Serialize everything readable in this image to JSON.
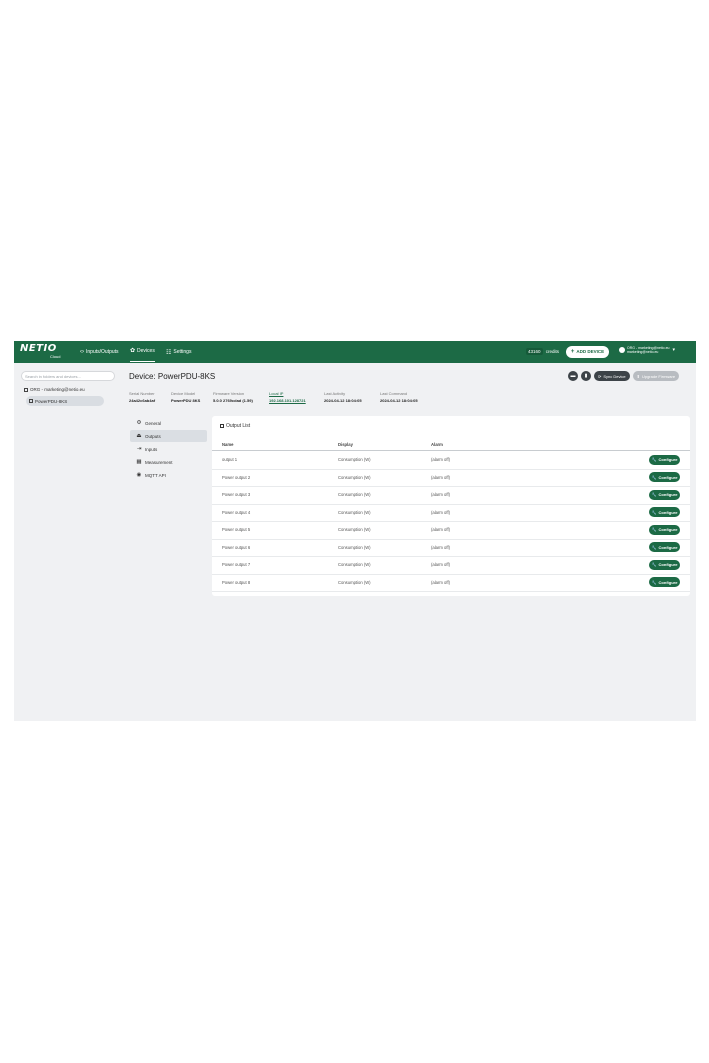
{
  "brand": {
    "logo": "NETIO",
    "sub": "Cloud"
  },
  "nav": [
    {
      "label": "Inputs/Outputs",
      "icon": "‹›"
    },
    {
      "label": "Devices",
      "icon": "✿"
    },
    {
      "label": "Settings",
      "icon": "☷"
    }
  ],
  "credits": {
    "value": "43160",
    "label": "credits"
  },
  "add_device": {
    "icon": "+",
    "label": "ADD DEVICE"
  },
  "user": {
    "org": "ORG - marketing@netio.eu",
    "email": "marketing@netio.eu",
    "chevron": "▾"
  },
  "sidebar": {
    "search_placeholder": "Search in folders and devices...",
    "org": "ORG - marketing@netio.eu",
    "device": "PowerPDU-8KS"
  },
  "device": {
    "title": "Device: PowerPDU-8KS",
    "actions": {
      "sync": "Sync Device",
      "upgrade": "Upgrade Firmware"
    },
    "info": [
      {
        "key": "Serial Number",
        "value": "24a42c6ab4af"
      },
      {
        "key": "Device Model",
        "value": "PowerPDU 8KS"
      },
      {
        "key": "Firmware Version",
        "value": "5.0.0 2769cdad (1.59)"
      },
      {
        "key": "Local IP",
        "value": "192.168.101.128721"
      },
      {
        "key": "Last Activity",
        "value": "2024-04-12 18:04:05"
      },
      {
        "key": "Last Command",
        "value": "2024-04-12 18:04:05"
      }
    ]
  },
  "menu": [
    {
      "label": "General",
      "icon": "⚙"
    },
    {
      "label": "Outputs",
      "icon": "⏏"
    },
    {
      "label": "Inputs",
      "icon": "⇥"
    },
    {
      "label": "Measurement",
      "icon": "▦"
    },
    {
      "label": "MQTT API",
      "icon": "◉"
    }
  ],
  "output_list": {
    "title": "Output List",
    "columns": [
      "Name",
      "Display",
      "Alarm"
    ],
    "configure_label": "Configure",
    "rows": [
      {
        "name": "output 1",
        "display": "Consumption (W)",
        "alarm": "(alarm off)"
      },
      {
        "name": "Power output 2",
        "display": "Consumption (W)",
        "alarm": "(alarm off)"
      },
      {
        "name": "Power output 3",
        "display": "Consumption (W)",
        "alarm": "(alarm off)"
      },
      {
        "name": "Power output 4",
        "display": "Consumption (W)",
        "alarm": "(alarm off)"
      },
      {
        "name": "Power output 5",
        "display": "Consumption (W)",
        "alarm": "(alarm off)"
      },
      {
        "name": "Power output 6",
        "display": "Consumption (W)",
        "alarm": "(alarm off)"
      },
      {
        "name": "Power output 7",
        "display": "Consumption (W)",
        "alarm": "(alarm off)"
      },
      {
        "name": "Power output 8",
        "display": "Consumption (W)",
        "alarm": "(alarm off)"
      }
    ]
  },
  "colors": {
    "brand": "#1c6a45",
    "background": "#f0f1f3"
  }
}
